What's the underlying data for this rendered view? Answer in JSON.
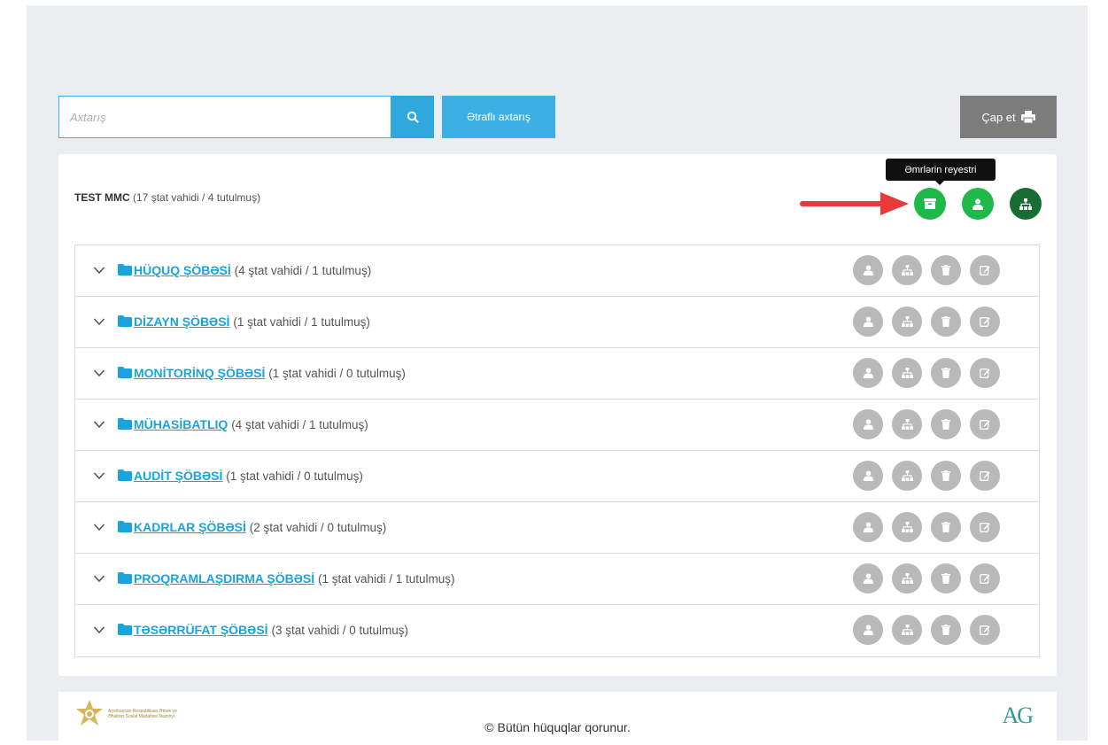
{
  "search": {
    "placeholder": "Axtarış",
    "advanced_label": "Ətraflı axtarış",
    "print_label": "Çap et"
  },
  "company": {
    "name": "TEST MMC",
    "meta": "(17 ştat vahidi / 4 tutulmuş)",
    "tooltip": "Əmrlərin reyestri"
  },
  "departments": [
    {
      "name": "HÜQUQ ŞÖBƏSİ",
      "meta": "(4 ştat vahidi / 1 tutulmuş)"
    },
    {
      "name": "DİZAYN ŞÖBƏSİ",
      "meta": "(1 ştat vahidi / 1 tutulmuş)"
    },
    {
      "name": "MONİTORİNQ ŞÖBƏSİ",
      "meta": "(1 ştat vahidi / 0 tutulmuş)"
    },
    {
      "name": "MÜHASİBATLIQ",
      "meta": "(4 ştat vahidi / 1 tutulmuş)"
    },
    {
      "name": "AUDİT ŞÖBƏSİ",
      "meta": "(1 ştat vahidi / 0 tutulmuş)"
    },
    {
      "name": "KADRLAR ŞÖBƏSİ",
      "meta": "(2 ştat vahidi / 0 tutulmuş)"
    },
    {
      "name": "PROQRAMLAŞDIRMA ŞÖBƏSİ",
      "meta": "(1 ştat vahidi / 1 tutulmuş)"
    },
    {
      "name": "TƏSƏRRÜFAT ŞÖBƏSİ",
      "meta": "(3 ştat vahidi / 0 tutulmuş)"
    }
  ],
  "footer": {
    "logo_text": "Azərbaycan Respublikası Əmək və Əhalinin Sosial Müdafiəsi Nazirliyi",
    "copyright": "© Bütün hüquqlar qorunur.",
    "ag_logo": "AG"
  },
  "colors": {
    "accent": "#2ea8dd",
    "link": "#1aa3dc",
    "green": "#1fb94a",
    "dark_green": "#186e32",
    "gray_btn": "#b9b9b9"
  }
}
